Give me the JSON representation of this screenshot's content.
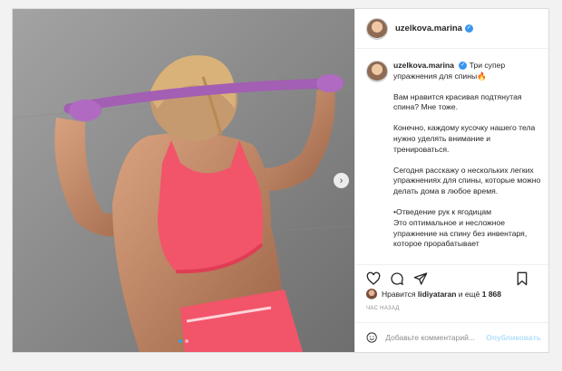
{
  "post": {
    "username": "uzelkova.marina",
    "caption_title": "Три супер упражнения для спины🔥",
    "caption_paragraphs": [
      "Вам нравится красивая подтянутая спина? Мне тоже.",
      "Конечно, каждому кусочку нашего тела нужно уделять внимание и тренироваться.",
      "Сегодня расскажу о нескольких легких упражнениях для спины, которые можно делать дома в любое время.",
      "•Отведение рук к ягодицам\nЭто оптимальное и несложное упражнение на спину без инвентаря, которое прорабатывает"
    ],
    "likes_prefix": "Нравится",
    "likes_user": "lidiyataran",
    "likes_suffix": "и ещё",
    "likes_count": "1 868",
    "timestamp": "ЧАС НАЗАД",
    "comment_placeholder": "Добавьте комментарий...",
    "post_button": "Опубликовать",
    "carousel_total": 2,
    "carousel_index": 1
  },
  "icons": [
    "heart-icon",
    "comment-icon",
    "share-icon",
    "bookmark-icon",
    "emoji-icon",
    "next-arrow-icon",
    "verified-icon"
  ],
  "colors": {
    "accent": "#3897f0",
    "post_button_disabled": "#b2dffc",
    "top_pink": "#f2546a",
    "band_purple": "#a35fb3"
  }
}
